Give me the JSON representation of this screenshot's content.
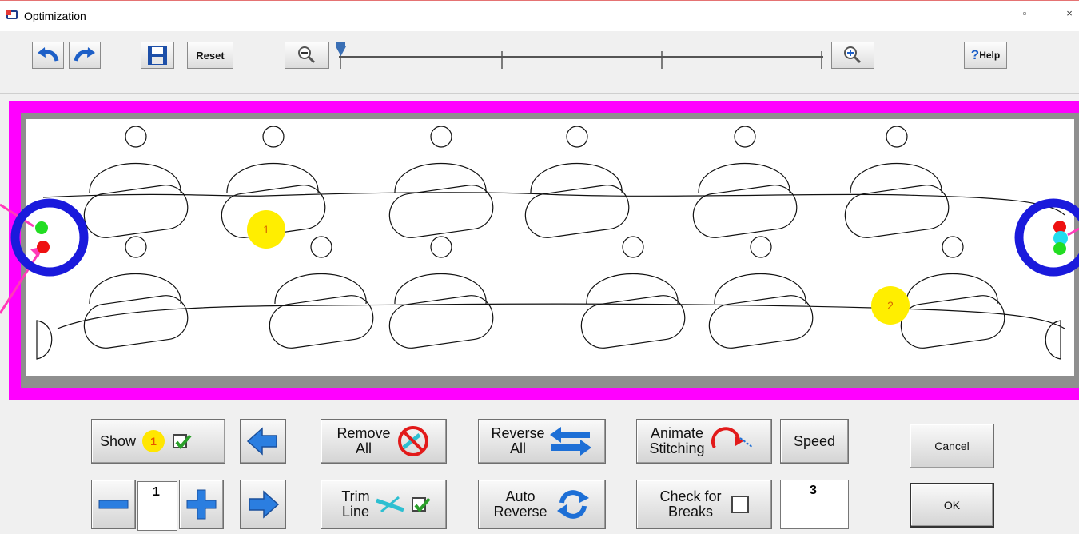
{
  "window": {
    "title": "Optimization",
    "minimize": "–",
    "restore": "▫",
    "close": "×"
  },
  "toolbar": {
    "undo_icon": "undo-icon",
    "redo_icon": "redo-icon",
    "save_icon": "save-icon",
    "reset_label": "Reset",
    "zoom_out_icon": "zoom-out-icon",
    "zoom_in_icon": "zoom-in-icon",
    "zoom_level": 0,
    "help_label": "Help",
    "help_mark": "?"
  },
  "canvas": {
    "sequence_labels": [
      "1",
      "2"
    ],
    "colors": {
      "border": "#ff00ff",
      "start": "#22dd22",
      "end": "#ee1111",
      "marker": "#ffee00",
      "highlight": "#1a1adc"
    }
  },
  "controls": {
    "show_label": "Show",
    "show_number": "1",
    "show_checked": true,
    "remove_all_label": [
      "Remove",
      "All"
    ],
    "reverse_all_label": [
      "Reverse",
      "All"
    ],
    "animate_label": [
      "Animate",
      "Stitching"
    ],
    "speed_label": "Speed",
    "cancel_label": "Cancel",
    "step_value": "1",
    "trim_label": [
      "Trim",
      "Line"
    ],
    "trim_checked": true,
    "auto_reverse_label": [
      "Auto",
      "Reverse"
    ],
    "check_breaks_label": [
      "Check for",
      "Breaks"
    ],
    "check_breaks_checked": false,
    "speed_value": "3",
    "ok_label": "OK"
  }
}
